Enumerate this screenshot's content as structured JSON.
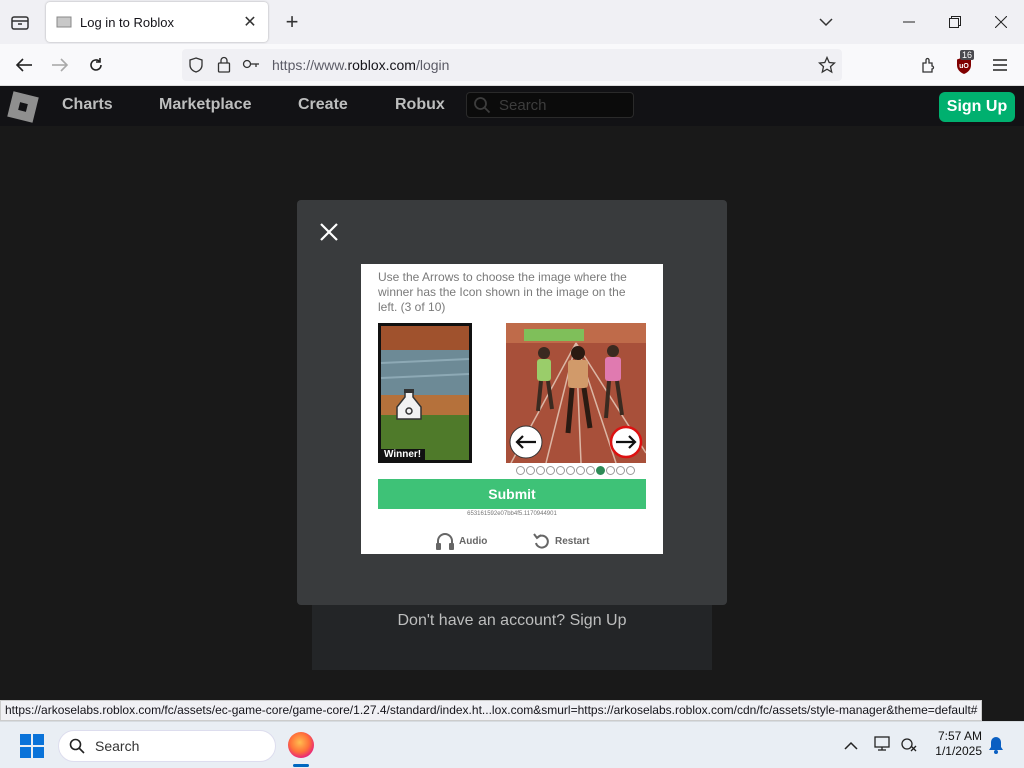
{
  "browser": {
    "tab_title": "Log in to Roblox",
    "url_prefix": "https://www.",
    "url_domain": "roblox.com",
    "url_path": "/login",
    "extension_badge": "16"
  },
  "roblox_header": {
    "nav": [
      "Charts",
      "Marketplace",
      "Create",
      "Robux"
    ],
    "search_placeholder": "Search",
    "signup_label": "Sign Up"
  },
  "page": {
    "signup_prompt": "Don't have an account? Sign Up"
  },
  "captcha": {
    "instruction": "Use the Arrows to choose the image where the winner has the Icon shown in the image on the left. (3 of 10)",
    "left_badge": "Winner!",
    "submit_label": "Submit",
    "session_id": "653161592e07bb4f5.1170944901",
    "audio_label": "Audio",
    "restart_label": "Restart",
    "progress": {
      "current": 9,
      "total": 12
    }
  },
  "status_url": "https://arkoselabs.roblox.com/fc/assets/ec-game-core/game-core/1.27.4/standard/index.ht...lox.com&smurl=https://arkoselabs.roblox.com/cdn/fc/assets/style-manager&theme=default#",
  "taskbar": {
    "search_label": "Search",
    "time": "7:57 AM",
    "date": "1/1/2025"
  },
  "colors": {
    "roblox_green": "#00b06f",
    "submit_green": "#3ec277",
    "modal_bg": "#393b3d"
  }
}
